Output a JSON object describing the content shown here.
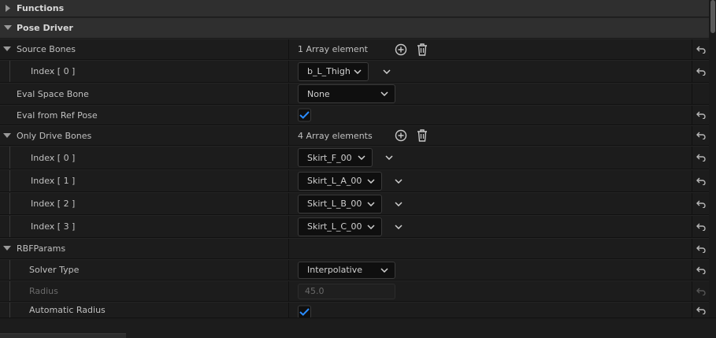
{
  "categories": {
    "functions": "Functions",
    "pose_driver": "Pose Driver"
  },
  "source_bones": {
    "label": "Source Bones",
    "count_text": "1 Array element",
    "items": [
      {
        "index_label": "Index [ 0 ]",
        "value": "b_L_Thigh"
      }
    ]
  },
  "eval_space_bone": {
    "label": "Eval Space Bone",
    "value": "None"
  },
  "eval_from_ref_pose": {
    "label": "Eval from Ref Pose",
    "checked": true
  },
  "only_drive_bones": {
    "label": "Only Drive Bones",
    "count_text": "4 Array elements",
    "items": [
      {
        "index_label": "Index [ 0 ]",
        "value": "Skirt_F_00"
      },
      {
        "index_label": "Index [ 1 ]",
        "value": "Skirt_L_A_00"
      },
      {
        "index_label": "Index [ 2 ]",
        "value": "Skirt_L_B_00"
      },
      {
        "index_label": "Index [ 3 ]",
        "value": "Skirt_L_C_00"
      }
    ]
  },
  "rbf_params": {
    "label": "RBFParams",
    "solver_type": {
      "label": "Solver Type",
      "value": "Interpolative"
    },
    "radius": {
      "label": "Radius",
      "value": "45.0"
    },
    "automatic_radius": {
      "label": "Automatic Radius",
      "checked": true
    }
  },
  "icons": {
    "expanded": "triangle-down-icon",
    "collapsed": "triangle-right-icon",
    "add": "add-element-icon",
    "delete": "trash-icon",
    "reset": "reset-to-default-icon",
    "dropdown": "chevron-down-icon",
    "check": "checkmark-icon"
  },
  "colors": {
    "accent_check": "#2a8cff",
    "panel_bg": "#242424",
    "row_bg": "#1c1c1c",
    "category_bg": "#2f2f2f"
  }
}
